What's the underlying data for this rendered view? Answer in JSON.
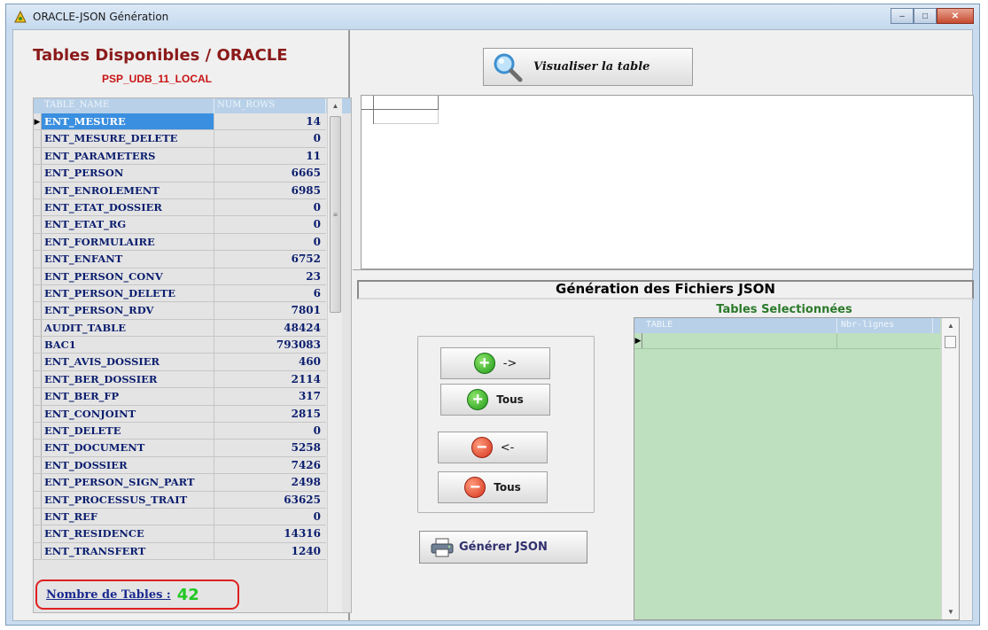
{
  "window": {
    "title": "ORACLE-JSON  Génération",
    "minimize_glyph": "–",
    "maximize_glyph": "□",
    "close_glyph": "✕"
  },
  "left": {
    "title": "Tables Disponibles / ORACLE",
    "subtitle": "PSP_UDB_11_LOCAL",
    "grid": {
      "columns": [
        "TABLE_NAME",
        "NUM_ROWS"
      ],
      "current_row_marker": "▶",
      "rows": [
        {
          "name": "ENT_MESURE",
          "rows": "14"
        },
        {
          "name": "ENT_MESURE_DELETE",
          "rows": "0"
        },
        {
          "name": "ENT_PARAMETERS",
          "rows": "11"
        },
        {
          "name": "ENT_PERSON",
          "rows": "6665"
        },
        {
          "name": "ENT_ENROLEMENT",
          "rows": "6985"
        },
        {
          "name": "ENT_ETAT_DOSSIER",
          "rows": "0"
        },
        {
          "name": "ENT_ETAT_RG",
          "rows": "0"
        },
        {
          "name": "ENT_FORMULAIRE",
          "rows": "0"
        },
        {
          "name": "ENT_ENFANT",
          "rows": "6752"
        },
        {
          "name": "ENT_PERSON_CONV",
          "rows": "23"
        },
        {
          "name": "ENT_PERSON_DELETE",
          "rows": "6"
        },
        {
          "name": "ENT_PERSON_RDV",
          "rows": "7801"
        },
        {
          "name": "AUDIT_TABLE",
          "rows": "48424"
        },
        {
          "name": "BAC1",
          "rows": "793083"
        },
        {
          "name": "ENT_AVIS_DOSSIER",
          "rows": "460"
        },
        {
          "name": "ENT_BER_DOSSIER",
          "rows": "2114"
        },
        {
          "name": "ENT_BER_FP",
          "rows": "317"
        },
        {
          "name": "ENT_CONJOINT",
          "rows": "2815"
        },
        {
          "name": "ENT_DELETE",
          "rows": "0"
        },
        {
          "name": "ENT_DOCUMENT",
          "rows": "5258"
        },
        {
          "name": "ENT_DOSSIER",
          "rows": "7426"
        },
        {
          "name": "ENT_PERSON_SIGN_PART",
          "rows": "2498"
        },
        {
          "name": "ENT_PROCESSUS_TRAIT",
          "rows": "63625"
        },
        {
          "name": "ENT_REF",
          "rows": "0"
        },
        {
          "name": "ENT_RESIDENCE",
          "rows": "14316"
        },
        {
          "name": "ENT_TRANSFERT",
          "rows": "1240"
        }
      ]
    },
    "count_label": "Nombre de Tables :",
    "count_value": "42"
  },
  "right": {
    "visual_button_label": "Visualiser la table",
    "generation_title": "Génération des Fichiers JSON",
    "selected_title": "Tables Selectionnées",
    "selected_columns": [
      "TABLE",
      "Nbr-lignes"
    ],
    "add_arrow": "->",
    "add_all_label": "Tous",
    "remove_arrow": "<-",
    "remove_all_label": "Tous",
    "generate_label": "Générer JSON"
  },
  "colors": {
    "title_red": "#8b1a1a",
    "subtitle_red": "#c81414",
    "count_green": "#21c821",
    "selected_grid_bg": "#bfe0bf",
    "header_blue": "#b8d0e8",
    "selection_blue": "#3b8fe0"
  }
}
